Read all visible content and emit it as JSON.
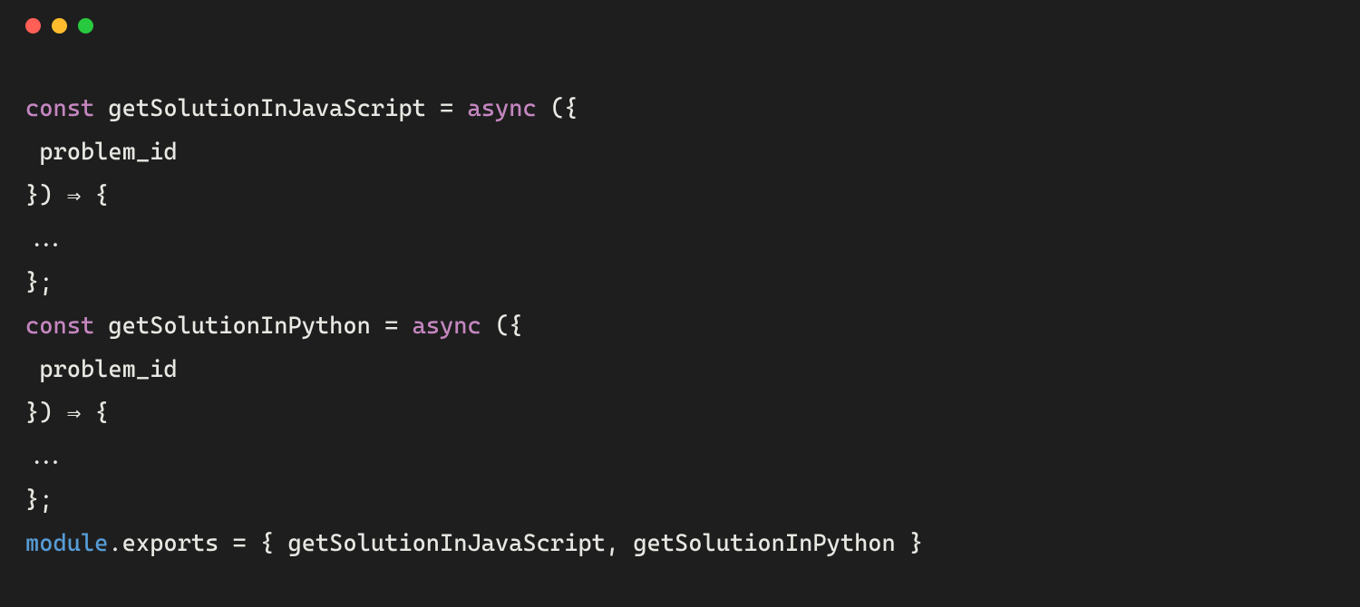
{
  "code": {
    "keyword_const": "const",
    "keyword_async": "async",
    "func1": "getSolutionInJavaScript",
    "func2": "getSolutionInPython",
    "param": "problem_id",
    "module_kw": "module",
    "exports_prop": "exports",
    "equals": " = ",
    "open_destruct": " ({",
    "close_destruct_arrow": "}) ⇒ {",
    "ellipsis": "...",
    "close_block": "};",
    "exports_open": " = { ",
    "exports_sep": ", ",
    "exports_close": " }",
    "dot": "."
  }
}
